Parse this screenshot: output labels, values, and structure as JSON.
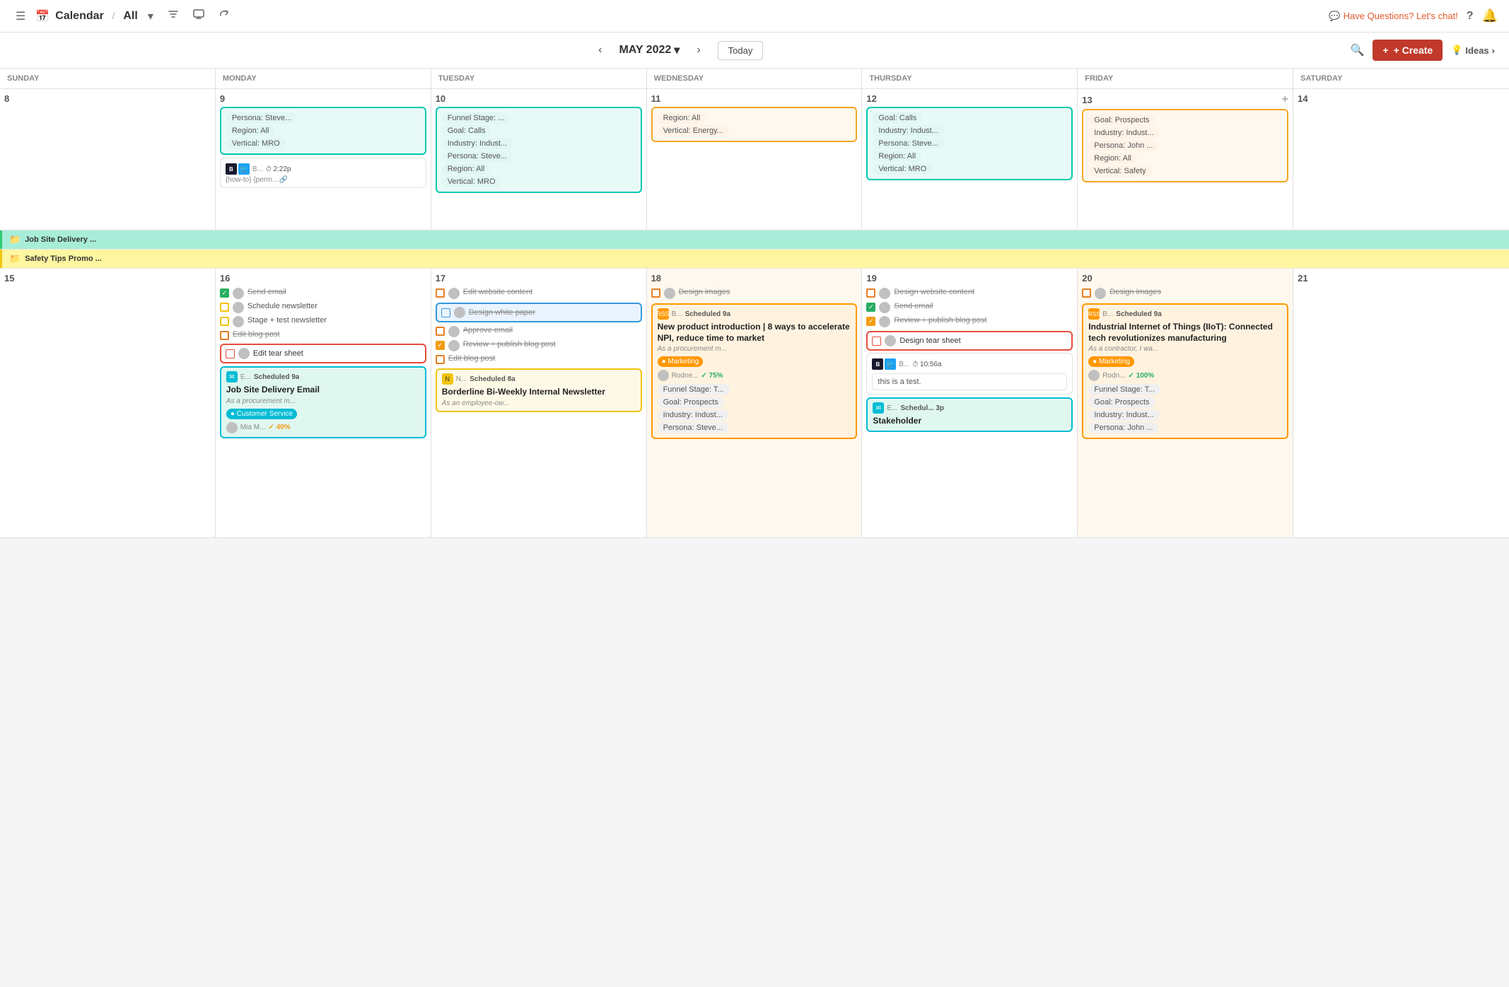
{
  "topNav": {
    "hamburger": "≡",
    "calendarIcon": "📅",
    "title": "Calendar",
    "separator": "/",
    "viewAll": "All",
    "filterIcon": "filter",
    "monitorIcon": "monitor",
    "shareIcon": "share",
    "chatText": "Have Questions? Let's chat!",
    "helpIcon": "?",
    "bellIcon": "🔔"
  },
  "calHeader": {
    "prevArrow": "‹",
    "nextArrow": "›",
    "monthTitle": "MAY 2022",
    "chevron": "▾",
    "todayLabel": "Today",
    "searchIcon": "🔍",
    "createLabel": "+ Create",
    "ideasLabel": "Ideas",
    "ideasChevron": "›"
  },
  "dayHeaders": [
    "SUNDAY",
    "MONDAY",
    "TUESDAY",
    "WEDNESDAY",
    "THURSDAY",
    "FRIDAY",
    "SATURDAY"
  ],
  "week1": {
    "days": [
      {
        "num": "8",
        "items": []
      },
      {
        "num": "9",
        "items": [
          {
            "type": "tags",
            "pills": [
              "Persona: Steve...",
              "Region: All",
              "Vertical: MRO"
            ]
          },
          {
            "type": "blog",
            "icons": [
              "B",
              "🐦"
            ],
            "time": "2:22p",
            "perm": "{how-to} {perm..."
          }
        ]
      },
      {
        "num": "10",
        "items": [
          {
            "type": "tags",
            "pills": [
              "Funnel Stage: ...",
              "Goal: Calls",
              "Industry: Indust...",
              "Persona: Steve...",
              "Region: All",
              "Vertical: MRO"
            ]
          }
        ]
      },
      {
        "num": "11",
        "items": [
          {
            "type": "tags",
            "pills": [
              "Region: All",
              "Vertical: Energy..."
            ]
          }
        ]
      },
      {
        "num": "12",
        "items": [
          {
            "type": "tags",
            "pills": [
              "Goal: Calls",
              "Industry: Indust...",
              "Persona: Steve...",
              "Region: All",
              "Vertical: MRO"
            ]
          }
        ]
      },
      {
        "num": "13",
        "items": [
          {
            "type": "tags",
            "pills": [
              "Goal: Prospects",
              "Industry: Indust...",
              "Persona: John ...",
              "Region: All",
              "Vertical: Safety"
            ]
          },
          {
            "type": "plus"
          }
        ]
      },
      {
        "num": "14",
        "items": []
      }
    ]
  },
  "spanRow1": {
    "label": "Job Site Delivery ...",
    "color": "teal"
  },
  "spanRow2": {
    "label": "Safety Tips Promo ...",
    "color": "yellow"
  },
  "week2": {
    "days": [
      {
        "num": "15",
        "items": []
      },
      {
        "num": "16",
        "items": [
          {
            "type": "task",
            "checked": true,
            "strikethrough": true,
            "avatar": true,
            "text": "Send email"
          },
          {
            "type": "task",
            "checked": "yellow",
            "strikethrough": false,
            "avatar": true,
            "text": "Schedule newsletter"
          },
          {
            "type": "task",
            "checked": "yellow",
            "strikethrough": false,
            "avatar": true,
            "text": "Stage + test newsletter"
          },
          {
            "type": "task",
            "checked": "orange-sq",
            "strikethrough": true,
            "avatar": false,
            "text": "Edit blog post"
          },
          {
            "type": "task-special",
            "checked": "red-sq",
            "avatar": true,
            "text": "Edit tear sheet",
            "border": "red"
          },
          {
            "type": "scheduled",
            "color": "teal",
            "icon": "✉",
            "title": "E...",
            "time": "Scheduled 9a",
            "cardTitle": "Job Site Delivery Email",
            "cardSubtitle": "As a procurement m...",
            "tag": "Customer Service",
            "tagColor": "teal",
            "avatar": true,
            "person": "Mia M...",
            "progress": "40%",
            "progressColor": "orange"
          }
        ]
      },
      {
        "num": "17",
        "items": [
          {
            "type": "task",
            "checked": "orange-sq",
            "strikethrough": true,
            "avatar": true,
            "text": "Edit website content"
          },
          {
            "type": "task-special",
            "checked": "blue-sq",
            "avatar": true,
            "text": "Design white paper",
            "border": "blue"
          },
          {
            "type": "task",
            "checked": "orange-sq",
            "strikethrough": true,
            "avatar": true,
            "text": "Approve email"
          },
          {
            "type": "task",
            "checked": "orange-ch",
            "strikethrough": true,
            "avatar": true,
            "text": "Review + publish blog post"
          },
          {
            "type": "task",
            "checked": "orange-sq",
            "strikethrough": true,
            "avatar": false,
            "text": "Edit blog post"
          },
          {
            "type": "scheduled",
            "color": "yellow",
            "icon": "N",
            "title": "N...",
            "time": "Scheduled 8a",
            "cardTitle": "Borderline Bi-Weekly Internal Newsletter",
            "cardSubtitle": "As an employee-ow..."
          }
        ]
      },
      {
        "num": "18",
        "items": [
          {
            "type": "task",
            "checked": "orange-sq",
            "strikethrough": true,
            "avatar": true,
            "text": "Design images"
          },
          {
            "type": "scheduled-card",
            "icon": "rss",
            "title": "B...",
            "time": "Scheduled 9a",
            "cardTitle": "New product introduction | 8 ways to accelerate NPI, reduce time to market",
            "cardSubtitle": "As a procurement m...",
            "tag": "Marketing",
            "tagColor": "orange",
            "avatar": true,
            "person": "Rodne...",
            "progress": "75%",
            "progressColor": "green",
            "tags": [
              "Funnel Stage: T...",
              "Goal: Prospects",
              "Industry: Indust...",
              "Persona: Steve..."
            ]
          }
        ]
      },
      {
        "num": "19",
        "items": [
          {
            "type": "task",
            "checked": "orange-sq",
            "strikethrough": true,
            "avatar": true,
            "text": "Design website content"
          },
          {
            "type": "task",
            "checked": "green-ch",
            "strikethrough": true,
            "avatar": true,
            "text": "Send email"
          },
          {
            "type": "task",
            "checked": "orange-ch",
            "strikethrough": true,
            "avatar": true,
            "text": "Review + publish blog post"
          },
          {
            "type": "task-special",
            "checked": "red-sq",
            "avatar": true,
            "text": "Design tear sheet",
            "border": "red"
          },
          {
            "type": "blog-row",
            "icons": [
              "B",
              "🐦"
            ],
            "time": "10:56a",
            "note": "this is a test."
          },
          {
            "type": "scheduled-partial",
            "icon": "✉",
            "title": "E...",
            "time": "Schedul... 3p",
            "cardTitle": "Stakeholder"
          }
        ]
      },
      {
        "num": "20",
        "items": [
          {
            "type": "task",
            "checked": "orange-sq",
            "strikethrough": true,
            "avatar": true,
            "text": "Design images"
          },
          {
            "type": "scheduled-card",
            "icon": "rss",
            "title": "B...",
            "time": "Scheduled 9a",
            "cardTitle": "Industrial Internet of Things (IIoT): Connected tech revolutionizes manufacturing",
            "cardSubtitle": "As a contractor, I wa...",
            "tag": "Marketing",
            "tagColor": "orange",
            "avatar": true,
            "person": "Rodn...",
            "progress": "100%",
            "progressColor": "green",
            "tags": [
              "Funnel Stage: T...",
              "Goal: Prospects",
              "Industry: Indust...",
              "Persona: John ..."
            ]
          }
        ]
      },
      {
        "num": "21",
        "items": []
      }
    ]
  }
}
